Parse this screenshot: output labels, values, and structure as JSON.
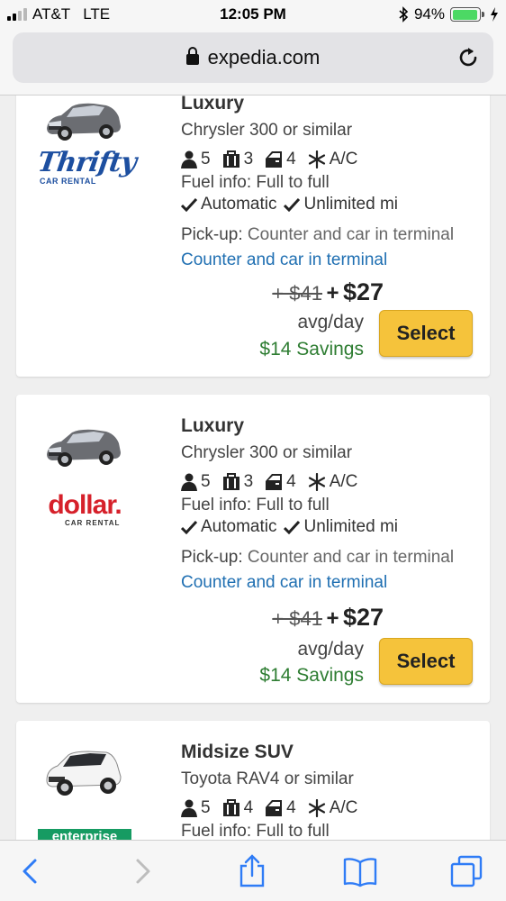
{
  "status_bar": {
    "carrier": "AT&T",
    "network": "LTE",
    "time": "12:05 PM",
    "battery_pct_label": "94%",
    "battery_level": 0.94,
    "bluetooth_icon": "bluetooth-icon",
    "charging_icon": "charging-bolt-icon"
  },
  "browser": {
    "url": "expedia.com",
    "lock_icon": "lock-icon",
    "reload_icon": "reload-icon"
  },
  "cards": [
    {
      "category": "Luxury",
      "model": "Chrysler 300 or similar",
      "brand": "Thrifty",
      "brand_sub": "CAR RENTAL",
      "passengers": "5",
      "bags": "3",
      "doors": "4",
      "ac": "A/C",
      "fuel": "Fuel info: Full to full",
      "transmission": "Automatic",
      "mileage": "Unlimited mi",
      "pickup_label": "Pick-up:",
      "pickup_value": "Counter and car in terminal",
      "pickup_link": "Counter and car in terminal",
      "old_price": "+ $41",
      "plus": "+",
      "new_price": "$27",
      "per": "avg/day",
      "savings": "$14 Savings",
      "select": "Select"
    },
    {
      "category": "Luxury",
      "model": "Chrysler 300 or similar",
      "brand": "dollar.",
      "brand_sub": "CAR RENTAL",
      "passengers": "5",
      "bags": "3",
      "doors": "4",
      "ac": "A/C",
      "fuel": "Fuel info: Full to full",
      "transmission": "Automatic",
      "mileage": "Unlimited mi",
      "pickup_label": "Pick-up:",
      "pickup_value": "Counter and car in terminal",
      "pickup_link": "Counter and car in terminal",
      "old_price": "+ $41",
      "plus": "+",
      "new_price": "$27",
      "per": "avg/day",
      "savings": "$14 Savings",
      "select": "Select"
    },
    {
      "category": "Midsize SUV",
      "model": "Toyota RAV4 or similar",
      "brand": "enterprise",
      "passengers": "5",
      "bags": "4",
      "doors": "4",
      "ac": "A/C",
      "fuel": "Fuel info: Full to full"
    }
  ],
  "toolbar": {
    "back_icon": "back-chevron-icon",
    "forward_icon": "forward-chevron-icon",
    "share_icon": "share-icon",
    "bookmarks_icon": "bookmarks-icon",
    "tabs_icon": "tabs-icon"
  },
  "colors": {
    "select_button": "#f5c33b",
    "savings_green": "#2e7d32",
    "link_blue": "#1f6fb2",
    "thrifty_blue": "#1d4fa0",
    "dollar_red": "#d6202a",
    "enterprise_green": "#169b62",
    "ios_blue": "#2f7cf6"
  }
}
